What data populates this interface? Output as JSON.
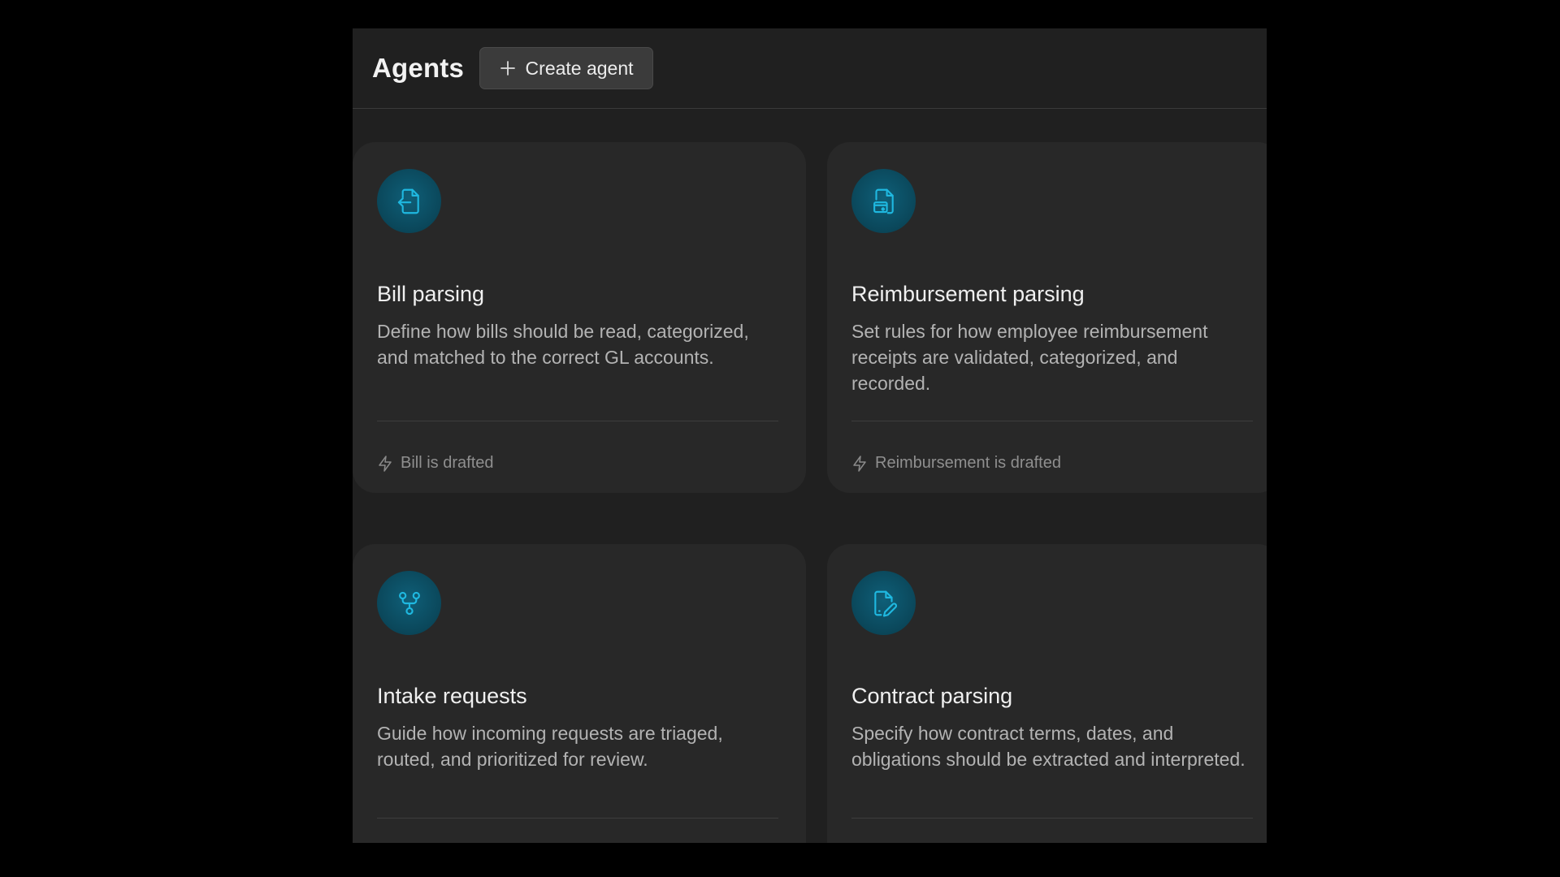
{
  "header": {
    "title": "Agents",
    "create_button_label": "Create agent"
  },
  "colors": {
    "background": "#000000",
    "panel": "#202020",
    "card": "#282828",
    "icon_badge": "#0b4a5e",
    "icon_stroke": "#1fb8e0"
  },
  "agents": [
    {
      "icon": "file-import-icon",
      "title": "Bill parsing",
      "description": "Define how bills should be read, categorized, and matched to the correct GL accounts.",
      "trigger_icon": "lightning-icon",
      "trigger": "Bill is drafted"
    },
    {
      "icon": "file-receipt-icon",
      "title": "Reimbursement parsing",
      "description": "Set rules for how employee reimbursement receipts are validated, categorized, and recorded.",
      "trigger_icon": "lightning-icon",
      "trigger": "Reimbursement is drafted"
    },
    {
      "icon": "git-branch-icon",
      "title": "Intake requests",
      "description": "Guide how incoming requests are triaged, routed, and prioritized for review."
    },
    {
      "icon": "file-signature-icon",
      "title": "Contract parsing",
      "description": "Specify how contract terms, dates, and obligations should be extracted and interpreted."
    }
  ]
}
